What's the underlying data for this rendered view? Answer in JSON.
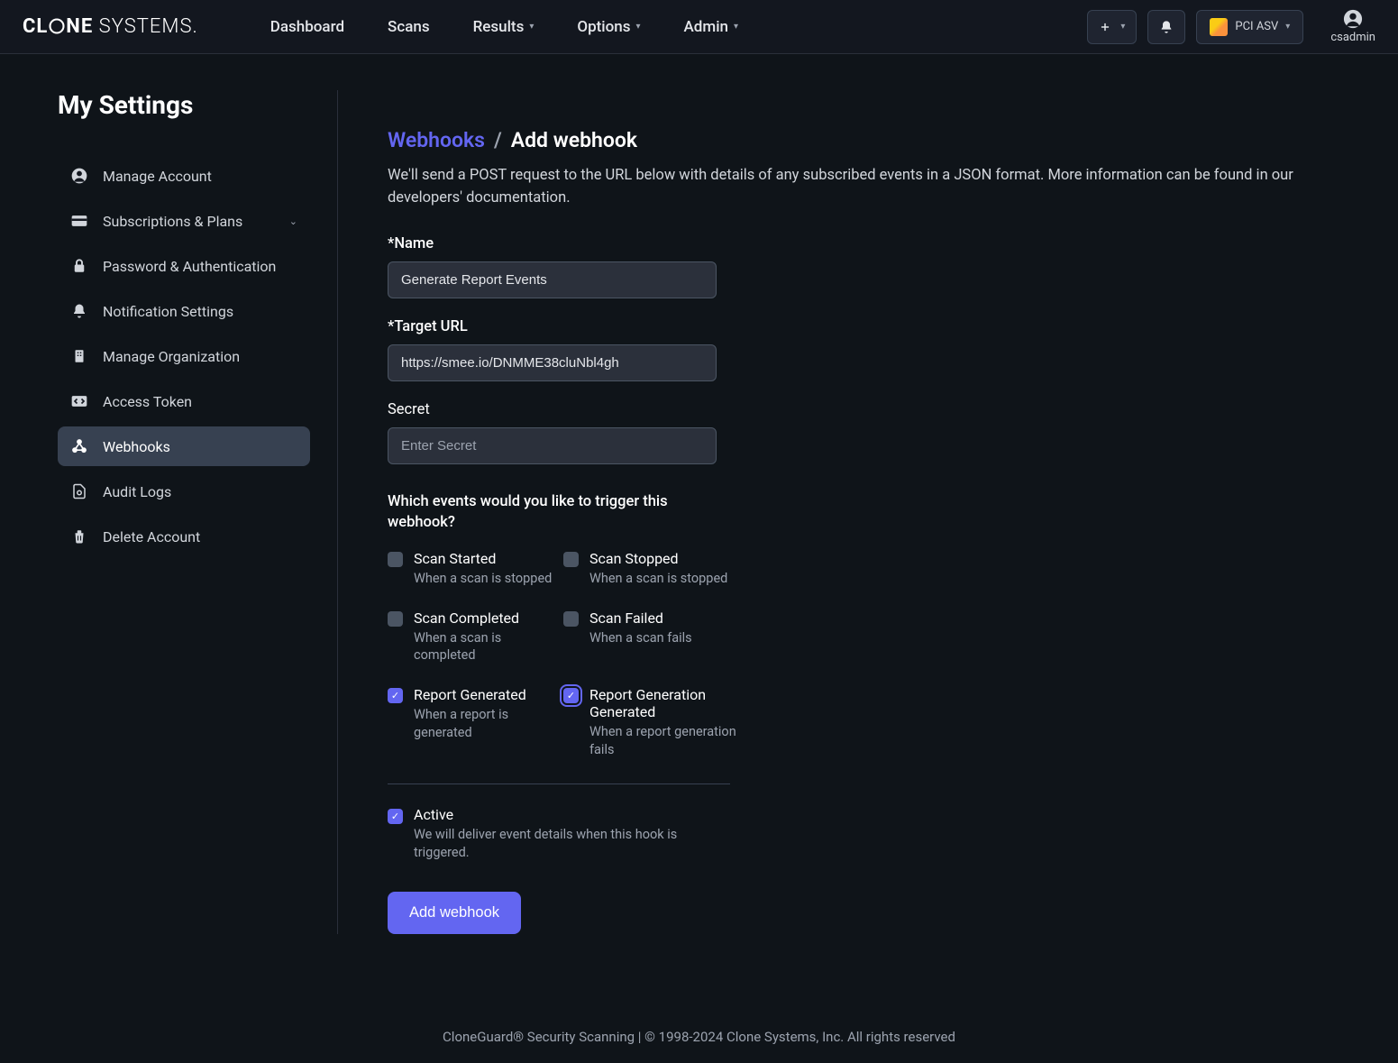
{
  "brand": {
    "part1": "CL",
    "part2": "NE",
    "part3": "SYSTEMS"
  },
  "nav": {
    "items": [
      {
        "label": "Dashboard",
        "dropdown": false
      },
      {
        "label": "Scans",
        "dropdown": false
      },
      {
        "label": "Results",
        "dropdown": true
      },
      {
        "label": "Options",
        "dropdown": true
      },
      {
        "label": "Admin",
        "dropdown": true
      }
    ],
    "pci_label": "PCI ASV",
    "user": "csadmin"
  },
  "page": {
    "title": "My Settings",
    "sidebar": [
      {
        "label": "Manage Account"
      },
      {
        "label": "Subscriptions & Plans",
        "expandable": true
      },
      {
        "label": "Password & Authentication"
      },
      {
        "label": "Notification Settings"
      },
      {
        "label": "Manage Organization"
      },
      {
        "label": "Access Token"
      },
      {
        "label": "Webhooks",
        "active": true
      },
      {
        "label": "Audit Logs"
      },
      {
        "label": "Delete Account"
      }
    ]
  },
  "main": {
    "breadcrumb": {
      "parent": "Webhooks",
      "current": "Add webhook"
    },
    "description": "We'll send a POST request to the URL below with details of any subscribed events in a JSON format. More information can be found in our developers' documentation.",
    "fields": {
      "name_label": "*Name",
      "name_value": "Generate Report Events",
      "url_label": "*Target URL",
      "url_value": "https://smee.io/DNMME38cluNbl4gh",
      "secret_label": "Secret",
      "secret_placeholder": "Enter Secret"
    },
    "events_heading": "Which events would you like to trigger this webhook?",
    "events": [
      {
        "title": "Scan Started",
        "desc": "When a scan is stopped",
        "checked": false,
        "focused": false
      },
      {
        "title": "Scan Stopped",
        "desc": "When a scan is stopped",
        "checked": false,
        "focused": false
      },
      {
        "title": "Scan Completed",
        "desc": "When a scan is completed",
        "checked": false,
        "focused": false
      },
      {
        "title": "Scan Failed",
        "desc": "When a scan fails",
        "checked": false,
        "focused": false
      },
      {
        "title": "Report Generated",
        "desc": "When a report is generated",
        "checked": true,
        "focused": false
      },
      {
        "title": "Report Generation Generated",
        "desc": "When a report generation fails",
        "checked": true,
        "focused": true
      }
    ],
    "active": {
      "title": "Active",
      "desc": "We will deliver event details when this hook is triggered.",
      "checked": true
    },
    "submit_label": "Add webhook"
  },
  "footer": "CloneGuard® Security Scanning | © 1998-2024 Clone Systems, Inc. All rights reserved"
}
